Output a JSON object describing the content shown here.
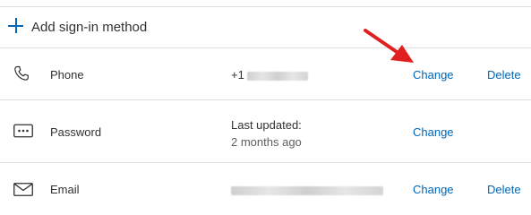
{
  "add_method": {
    "label": "Add sign-in method",
    "icon": "plus-icon",
    "accent": "#0067b8"
  },
  "methods": [
    {
      "name": "Phone",
      "icon": "phone-icon",
      "detail_prefix": "+1",
      "change_label": "Change",
      "delete_label": "Delete"
    },
    {
      "name": "Password",
      "icon": "password-icon",
      "detail_line1": "Last updated:",
      "detail_line2": "2 months ago",
      "change_label": "Change"
    },
    {
      "name": "Email",
      "icon": "mail-icon",
      "change_label": "Change",
      "delete_label": "Delete"
    }
  ],
  "annotation": {
    "icon": "red-arrow-icon",
    "color": "#e02020"
  }
}
